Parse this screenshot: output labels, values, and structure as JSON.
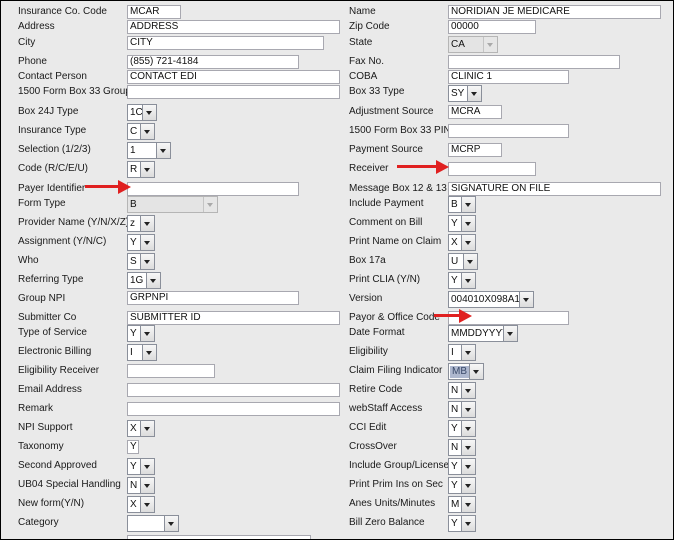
{
  "left": {
    "insurance_co_code": {
      "label": "Insurance Co. Code",
      "value": "MCAR"
    },
    "address": {
      "label": "Address",
      "value": "ADDRESS"
    },
    "city": {
      "label": "City",
      "value": "CITY"
    },
    "phone": {
      "label": "Phone",
      "value": "(855) 721-4184"
    },
    "contact_person": {
      "label": "Contact Person",
      "value": "CONTACT EDI"
    },
    "box33_group": {
      "label": "1500 Form Box 33 Group",
      "value": ""
    },
    "box24j_type": {
      "label": "Box 24J Type",
      "value": "1C"
    },
    "insurance_type": {
      "label": "Insurance Type",
      "value": "C"
    },
    "selection": {
      "label": "Selection (1/2/3)",
      "value": "1"
    },
    "code": {
      "label": "Code (R/C/E/U)",
      "value": "R"
    },
    "payer_identifier": {
      "label": "Payer Identifier",
      "value": ""
    },
    "form_type": {
      "label": "Form Type",
      "value": "B"
    },
    "provider_name": {
      "label": "Provider Name (Y/N/X/Z)",
      "value": "z"
    },
    "assignment": {
      "label": "Assignment (Y/N/C)",
      "value": "Y"
    },
    "who": {
      "label": "Who",
      "value": "S"
    },
    "referring_type": {
      "label": "Referring Type",
      "value": "1G"
    },
    "group_npi": {
      "label": "Group NPI",
      "value": "GRPNPI"
    },
    "submitter_co": {
      "label": "Submitter Co",
      "value": "SUBMITTER ID"
    },
    "type_of_service": {
      "label": "Type of Service",
      "value": "Y"
    },
    "electronic_billing": {
      "label": "Electronic Billing",
      "value": "I"
    },
    "eligibility_receiver": {
      "label": "Eligibility Receiver",
      "value": ""
    },
    "email_address": {
      "label": "Email Address",
      "value": ""
    },
    "remark": {
      "label": "Remark",
      "value": ""
    },
    "npi_support": {
      "label": "NPI Support",
      "value": "X"
    },
    "taxonomy": {
      "label": "Taxonomy",
      "value": "Y"
    },
    "second_approved": {
      "label": "Second Approved",
      "value": "Y"
    },
    "ub04_special_handling": {
      "label": "UB04 Special Handling",
      "value": "N"
    },
    "new_form": {
      "label": "New form(Y/N)",
      "value": "X"
    },
    "category": {
      "label": "Category",
      "value": ""
    }
  },
  "right": {
    "name": {
      "label": "Name",
      "value": "NORIDIAN JE MEDICARE"
    },
    "zip_code": {
      "label": "Zip Code",
      "value": "00000"
    },
    "state": {
      "label": "State",
      "value": "CA"
    },
    "fax_no": {
      "label": "Fax No.",
      "value": ""
    },
    "coba": {
      "label": "COBA",
      "value": "CLINIC 1"
    },
    "box33_type": {
      "label": "Box 33 Type",
      "value": "SY"
    },
    "adjustment_source": {
      "label": "Adjustment Source",
      "value": "MCRA"
    },
    "box33_pin": {
      "label": "1500 Form Box 33 PIN",
      "value": ""
    },
    "payment_source": {
      "label": "Payment Source",
      "value": "MCRP"
    },
    "receiver": {
      "label": "Receiver",
      "value": ""
    },
    "message_box": {
      "label": "Message Box 12 & 13",
      "value": "SIGNATURE ON FILE"
    },
    "include_payment": {
      "label": "Include Payment",
      "value": "B"
    },
    "comment_on_bill": {
      "label": "Comment on Bill",
      "value": "Y"
    },
    "print_name_on_claim": {
      "label": "Print Name on Claim",
      "value": "X"
    },
    "box17a": {
      "label": "Box 17a",
      "value": "U"
    },
    "print_clia": {
      "label": "Print CLIA (Y/N)",
      "value": "Y"
    },
    "version": {
      "label": "Version",
      "value": "004010X098A1"
    },
    "payor_office_code": {
      "label": "Payor & Office Code",
      "value": ""
    },
    "date_format": {
      "label": "Date Format",
      "value": "MMDDYYYY"
    },
    "eligibility": {
      "label": "Eligibility",
      "value": "I"
    },
    "claim_filing_indicator": {
      "label": "Claim Filing Indicator",
      "value": "MB"
    },
    "retire_code": {
      "label": "Retire Code",
      "value": "N"
    },
    "webstaff_access": {
      "label": "webStaff Access",
      "value": "N"
    },
    "cci_edit": {
      "label": "CCI Edit",
      "value": "Y"
    },
    "crossover": {
      "label": "CrossOver",
      "value": "N"
    },
    "include_group_license": {
      "label": "Include Group/License",
      "value": "Y"
    },
    "print_prim_ins_on_sec": {
      "label": "Print Prim Ins on Sec",
      "value": "Y"
    },
    "anes_units_minutes": {
      "label": "Anes Units/Minutes",
      "value": "M"
    },
    "bill_zero_balance": {
      "label": "Bill Zero Balance",
      "value": "Y"
    }
  },
  "colors": {
    "background": "#eaeaea",
    "field": "#ffffff",
    "annotation_arrow": "#e02020",
    "highlight": "#aeb8cf"
  }
}
